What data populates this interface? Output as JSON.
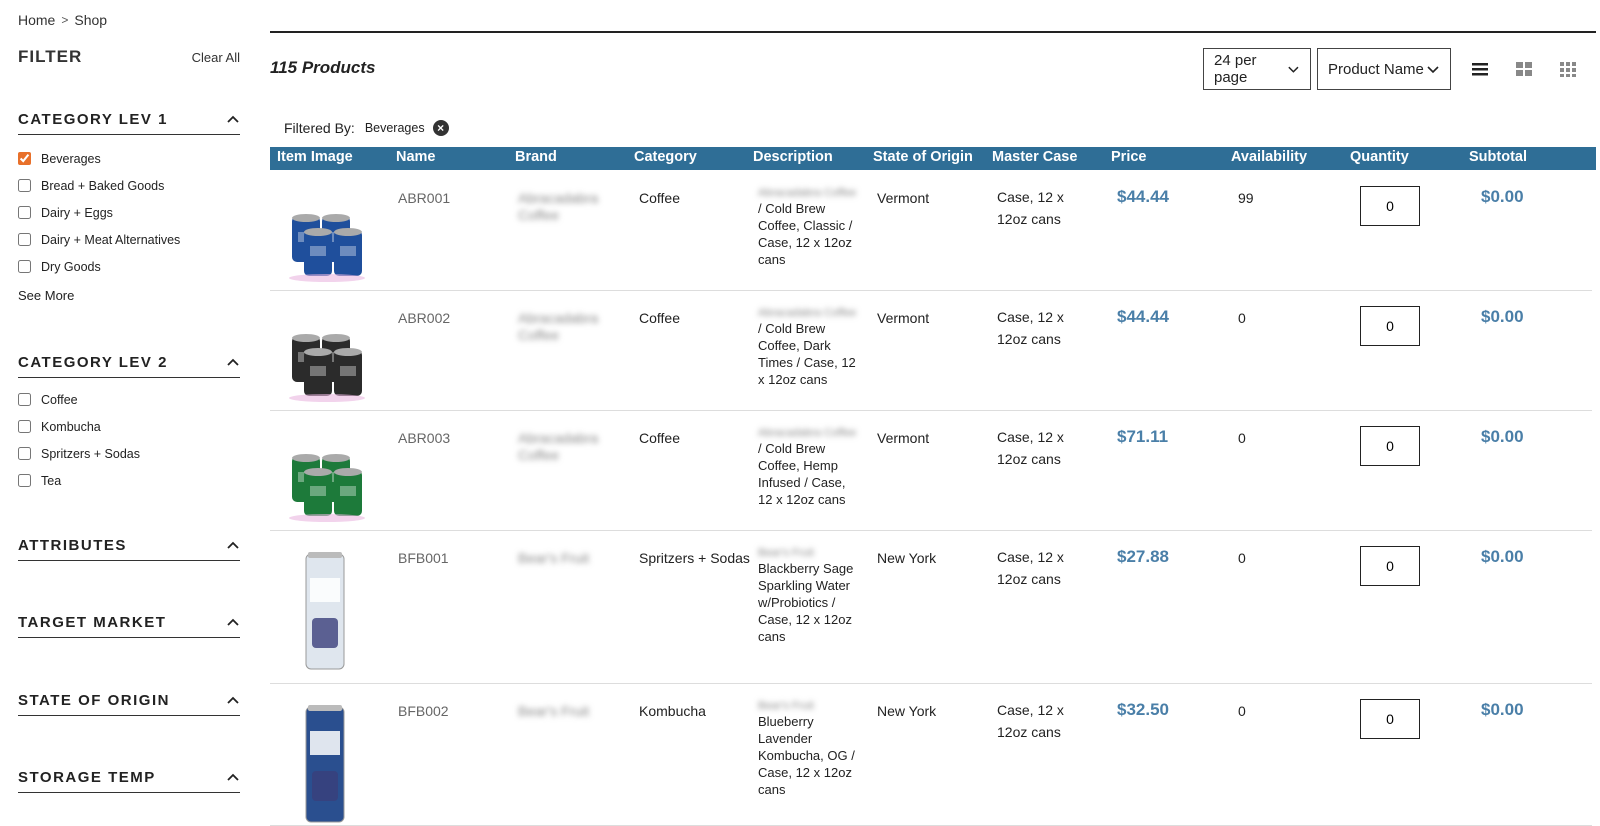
{
  "breadcrumb": {
    "home": "Home",
    "sep": ">",
    "current": "Shop"
  },
  "sidebar": {
    "filter_title": "FILTER",
    "clear_all": "Clear All",
    "cat1": {
      "title": "CATEGORY LEV 1",
      "options": [
        {
          "label": "Beverages",
          "checked": true
        },
        {
          "label": "Bread + Baked Goods",
          "checked": false
        },
        {
          "label": "Dairy + Eggs",
          "checked": false
        },
        {
          "label": "Dairy + Meat Alternatives",
          "checked": false
        },
        {
          "label": "Dry Goods",
          "checked": false
        }
      ],
      "see_more": "See More"
    },
    "cat2": {
      "title": "CATEGORY LEV 2",
      "options": [
        {
          "label": "Coffee",
          "checked": false
        },
        {
          "label": "Kombucha",
          "checked": false
        },
        {
          "label": "Spritzers + Sodas",
          "checked": false
        },
        {
          "label": "Tea",
          "checked": false
        }
      ]
    },
    "attributes": "ATTRIBUTES",
    "target_market": "TARGET MARKET",
    "state_of_origin": "STATE OF ORIGIN",
    "storage_temp": "STORAGE TEMP"
  },
  "main": {
    "count": "115 Products",
    "per_page": "24 per page",
    "sort": "Product Name",
    "filtered_by_label": "Filtered By:",
    "filtered_by_value": "Beverages"
  },
  "table": {
    "headers": [
      "Item Image",
      "Name",
      "Brand",
      "Category",
      "Description",
      "State of Origin",
      "Master Case",
      "Price",
      "Availability",
      "Quantity",
      "Subtotal"
    ],
    "rows": [
      {
        "sku": "ABR001",
        "brand": "Abracadabra Coffee",
        "category": "Coffee",
        "desc_brand": "Abracadabra Coffee",
        "desc": "/ Cold Brew Coffee, Classic / Case, 12 x 12oz cans",
        "state": "Vermont",
        "case": "Case, 12 x 12oz cans",
        "price": "$44.44",
        "availability": "99",
        "quantity": "0",
        "subtotal": "$0.00",
        "can_color": "#1f4f9c"
      },
      {
        "sku": "ABR002",
        "brand": "Abracadabra Coffee",
        "category": "Coffee",
        "desc_brand": "Abracadabra Coffee",
        "desc": "/ Cold Brew Coffee, Dark Times / Case, 12 x 12oz cans",
        "state": "Vermont",
        "case": "Case, 12 x 12oz cans",
        "price": "$44.44",
        "availability": "0",
        "quantity": "0",
        "subtotal": "$0.00",
        "can_color": "#2b2b2b"
      },
      {
        "sku": "ABR003",
        "brand": "Abracadabra Coffee",
        "category": "Coffee",
        "desc_brand": "Abracadabra Coffee",
        "desc": "/ Cold Brew Coffee, Hemp Infused / Case, 12 x 12oz cans",
        "state": "Vermont",
        "case": "Case, 12 x 12oz cans",
        "price": "$71.11",
        "availability": "0",
        "quantity": "0",
        "subtotal": "$0.00",
        "can_color": "#1d7a3a"
      },
      {
        "sku": "BFB001",
        "brand": "Bear's Fruit",
        "category": "Spritzers + Sodas",
        "desc_brand": "Bear's Fruit",
        "desc": "Blackberry Sage Sparkling Water w/Probiotics / Case, 12 x 12oz cans",
        "state": "New York",
        "case": "Case, 12 x 12oz cans",
        "price": "$27.88",
        "availability": "0",
        "quantity": "0",
        "subtotal": "$0.00",
        "can_color": "#dfe6ee"
      },
      {
        "sku": "BFB002",
        "brand": "Bear's Fruit",
        "category": "Kombucha",
        "desc_brand": "Bear's Fruit",
        "desc": "Blueberry Lavender Kombucha, OG / Case, 12 x 12oz cans",
        "state": "New York",
        "case": "Case, 12 x 12oz cans",
        "price": "$32.50",
        "availability": "0",
        "quantity": "0",
        "subtotal": "$0.00",
        "can_color": "#2a4f8f"
      }
    ]
  },
  "colors": {
    "header_bg": "#2f6e96",
    "price": "#4a7fa8",
    "checkbox_checked": "#e8702a"
  },
  "icons": [
    "chevron-up-icon",
    "chevron-down-icon",
    "list-view-icon",
    "grid-view-icon",
    "compact-grid-icon",
    "remove-filter-icon"
  ]
}
